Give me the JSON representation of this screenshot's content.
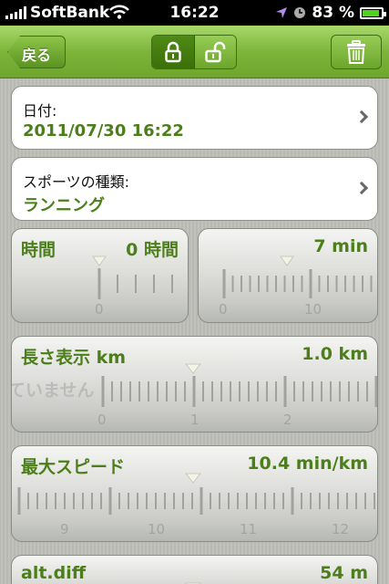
{
  "status": {
    "carrier": "SoftBank",
    "time": "16:22",
    "battery": "83 %",
    "battery_level": 0.83
  },
  "nav": {
    "back_label": "戻る",
    "lock_icon": "lock-closed-icon",
    "unlock_icon": "lock-open-icon",
    "trash_icon": "trash-icon"
  },
  "date_row": {
    "label": "日付:",
    "value": "2011/07/30 16:22"
  },
  "sport_row": {
    "label": "スポーツの種類:",
    "value": "ランニング"
  },
  "time_hours": {
    "title": "時間",
    "value": "0 時間",
    "labels": [
      "0"
    ]
  },
  "time_minutes": {
    "value": "7 min",
    "labels": [
      "0",
      "10"
    ]
  },
  "distance": {
    "title": "長さ表示 km",
    "value": "1.0 km",
    "ghost": "ていません",
    "labels": [
      "0",
      "1",
      "2"
    ]
  },
  "max_speed": {
    "title": "最大スピード",
    "value": "10.4 min/km",
    "labels": [
      "9",
      "10",
      "11",
      "12"
    ]
  },
  "alt_diff": {
    "title": "alt.diff",
    "value": "54 m"
  },
  "colors": {
    "accent": "#4c7f1b",
    "nav": "#7db53b"
  }
}
